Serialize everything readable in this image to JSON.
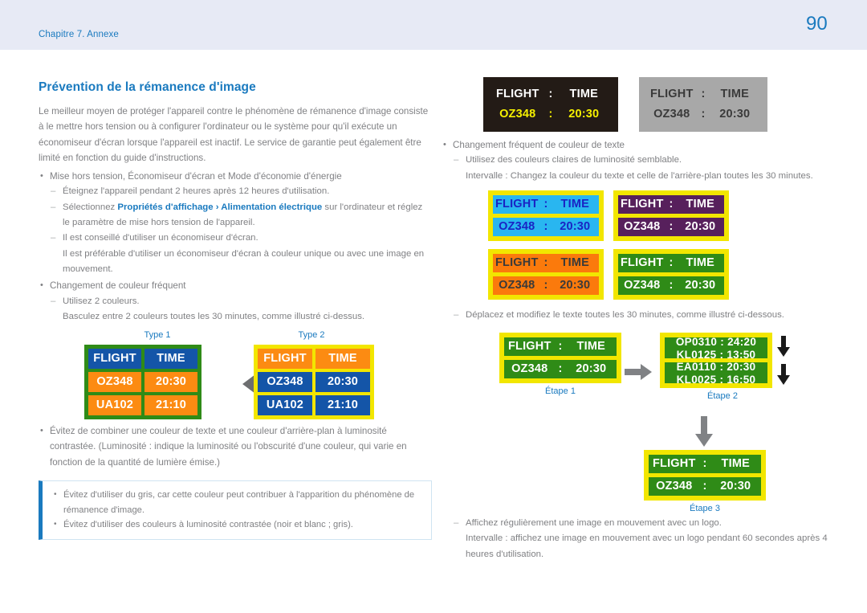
{
  "header": {
    "chapter": "Chapitre 7. Annexe",
    "page_number": "90"
  },
  "left": {
    "title": "Prévention de la rémanence d'image",
    "intro": "Le meilleur moyen de protéger l'appareil contre le phénomène de rémanence d'image consiste à le mettre hors tension ou à configurer l'ordinateur ou le système pour qu'il exécute un économiseur d'écran lorsque l'appareil est inactif. Le service de garantie peut également être limité en fonction du guide d'instructions.",
    "b1": "Mise hors tension, Économiseur d'écran et Mode d'économie d'énergie",
    "b1_s1": "Éteignez l'appareil pendant 2 heures après 12 heures d'utilisation.",
    "b1_s2_pre": "Sélectionnez ",
    "b1_s2_link1": "Propriétés d'affichage",
    "b1_s2_sep": " › ",
    "b1_s2_link2": "Alimentation électrique",
    "b1_s2_post": " sur l'ordinateur et réglez le paramètre de mise hors tension de l'appareil.",
    "b1_s3": "Il est conseillé d'utiliser un économiseur d'écran.",
    "b1_s3_cont": "Il est préférable d'utiliser un économiseur d'écran à couleur unique ou avec une image en mouvement.",
    "b2": "Changement de couleur fréquent",
    "b2_s1": "Utilisez 2 couleurs.",
    "b2_s1_cont": "Basculez entre 2 couleurs toutes les 30 minutes, comme illustré ci-dessus.",
    "b3": "Évitez de combiner une couleur de texte et une couleur d'arrière-plan à luminosité contrastée. (Luminosité : indique la luminosité ou l'obscurité d'une couleur, qui varie en fonction de la quantité de lumière émise.)",
    "note1": "Évitez d'utiliser du gris, car cette couleur peut contribuer à l'apparition du phénomène de rémanence d'image.",
    "note2": "Évitez d'utiliser des couleurs à luminosité contrastée (noir et blanc ; gris)."
  },
  "type_compare": {
    "type1_label": "Type 1",
    "type2_label": "Type 2",
    "arrow_icon": "double-headed-horizontal-arrow",
    "rows": [
      [
        "FLIGHT",
        "TIME"
      ],
      [
        "OZ348",
        "20:30"
      ],
      [
        "UA102",
        "21:10"
      ]
    ],
    "type1_colors": {
      "frame": "#2f8b17",
      "header_bg": "#1455a8",
      "header_fg": "#ffffff",
      "data_bg": "#fc8b12",
      "data_fg": "#ffffff"
    },
    "type2_colors": {
      "frame": "#f2e600",
      "header_bg": "#fc8b12",
      "header_fg": "#ffffff",
      "data_bg": "#1455a8",
      "data_fg": "#ffffff"
    }
  },
  "right": {
    "top_boards": [
      {
        "name": "dark-board",
        "bg": "#231b16",
        "header_fg": "#ffffff",
        "data_fg": "#f5f000",
        "header": [
          "FLIGHT",
          ":",
          "TIME"
        ],
        "data": [
          "OZ348",
          ":",
          "20:30"
        ]
      },
      {
        "name": "gray-board",
        "bg": "#a8a8a8",
        "header_fg": "#3a3a3a",
        "data_fg": "#3a3a3a",
        "header": [
          "FLIGHT",
          ":",
          "TIME"
        ],
        "data": [
          "OZ348",
          ":",
          "20:30"
        ]
      }
    ],
    "b_text_color": "Changement fréquent de couleur de texte",
    "b_text_s1": "Utilisez des couleurs claires de luminosité semblable.",
    "b_text_s1_cont": "Intervalle : Changez la couleur du texte et celle de l'arrière-plan toutes les 30 minutes.",
    "quad_boards": [
      {
        "name": "cyan-board",
        "frame": "#f2e600",
        "bg": "#29b6f0",
        "fg": "#1a23c4",
        "header": [
          "FLIGHT",
          ":",
          "TIME"
        ],
        "data": [
          "OZ348",
          ":",
          "20:30"
        ]
      },
      {
        "name": "purple-board",
        "frame": "#f2e600",
        "bg": "#57205c",
        "fg": "#ffffff",
        "header": [
          "FLIGHT",
          ":",
          "TIME"
        ],
        "data": [
          "OZ348",
          ":",
          "20:30"
        ]
      },
      {
        "name": "orange-board",
        "frame": "#f2e600",
        "bg": "#fb7a0c",
        "fg": "#3a3a3a",
        "header": [
          "FLIGHT",
          ":",
          "TIME"
        ],
        "data": [
          "OZ348",
          ":",
          "20:30"
        ]
      },
      {
        "name": "green-board",
        "frame": "#f2e600",
        "bg": "#2f8b17",
        "fg": "#ffffff",
        "header": [
          "FLIGHT",
          ":",
          "TIME"
        ],
        "data": [
          "OZ348",
          ":",
          "20:30"
        ]
      }
    ],
    "b_move": "Déplacez et modifiez le texte toutes les 30 minutes, comme illustré ci-dessous.",
    "steps": {
      "step1_label": "Étape 1",
      "step2_label": "Étape 2",
      "step3_label": "Étape 3",
      "right_arrow_icon": "right-arrow",
      "down_arrow_icon": "down-arrow",
      "scroll_arrow_icon": "scroll-down-arrow",
      "step1": {
        "header": [
          "FLIGHT",
          ":",
          "TIME"
        ],
        "data": [
          "OZ348",
          ":",
          "20:30"
        ]
      },
      "step2": {
        "pane1_top": "OP0310 : 24:20",
        "pane1_bottom": "KL0125 : 13:50",
        "pane2_top": "EA0110 : 20:30",
        "pane2_bottom": "KL0025 : 16:50"
      },
      "step3": {
        "header": [
          "FLIGHT",
          ":",
          "TIME"
        ],
        "data": [
          "OZ348",
          ":",
          "20:30"
        ]
      }
    },
    "b_logo": "Affichez régulièrement une image en mouvement avec un logo.",
    "b_logo_cont": "Intervalle : affichez une image en mouvement avec un logo pendant 60 secondes après 4 heures d'utilisation."
  }
}
